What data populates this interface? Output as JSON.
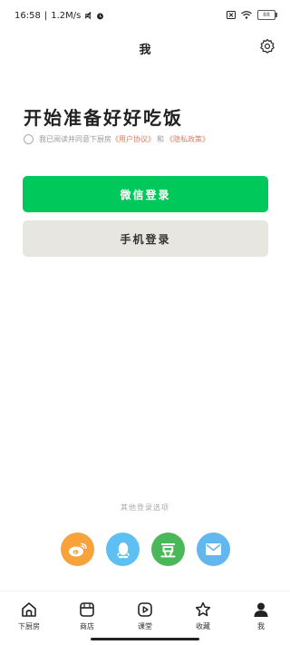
{
  "status": {
    "time": "16:58",
    "speed": "1.2M/s",
    "battery": "88"
  },
  "header": {
    "title": "我"
  },
  "main": {
    "headline": "开始准备好好吃饭",
    "agree_prefix": "我已阅读并同意下厨房",
    "user_agreement": "《用户协议》",
    "and": "和",
    "privacy_policy": "《隐私政策》",
    "wechat_login": "微信登录",
    "phone_login": "手机登录"
  },
  "other_login": {
    "label": "其他登录选项",
    "options": [
      {
        "icon": "weibo-icon",
        "color": "#f7a23b"
      },
      {
        "icon": "qq-icon",
        "color": "#5ec0f2"
      },
      {
        "icon": "douban-icon",
        "color": "#4ab858"
      },
      {
        "icon": "email-icon",
        "color": "#62b7ef"
      }
    ],
    "douban_glyph": "豆"
  },
  "tabbar": {
    "items": [
      {
        "label": "下厨房",
        "icon": "home-icon"
      },
      {
        "label": "商店",
        "icon": "store-icon"
      },
      {
        "label": "课堂",
        "icon": "play-icon"
      },
      {
        "label": "收藏",
        "icon": "star-icon"
      },
      {
        "label": "我",
        "icon": "person-icon"
      }
    ]
  }
}
